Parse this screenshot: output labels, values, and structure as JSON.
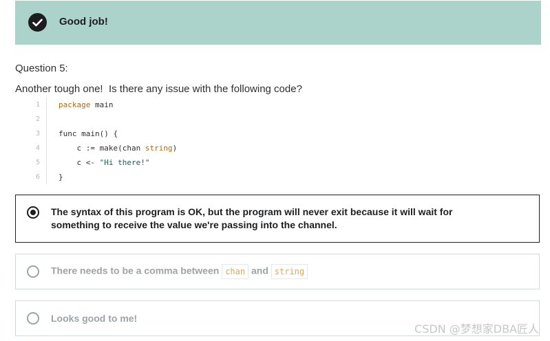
{
  "banner": {
    "message": "Good job!",
    "background": "#acd2cc",
    "icon": "check-circle-icon"
  },
  "question": {
    "label": "Question 5:",
    "prompt": "Another tough one!  Is there any issue with the following code?"
  },
  "code": {
    "lines": [
      {
        "num": "1",
        "text": "package main"
      },
      {
        "num": "2",
        "text": ""
      },
      {
        "num": "3",
        "text": "func main() {"
      },
      {
        "num": "4",
        "text": "    c := make(chan string)"
      },
      {
        "num": "5",
        "text": "    c <- \"Hi there!\""
      },
      {
        "num": "6",
        "text": "}"
      }
    ]
  },
  "options": [
    {
      "text_line1": "The syntax of this program is OK, but the program will never exit because it will wait for",
      "text_line2": "something to receive the value we're passing into the channel.",
      "selected": true
    },
    {
      "text_before": "There needs to be a comma between",
      "code1": "chan",
      "text_mid": "and",
      "code2": "string",
      "selected": false
    },
    {
      "text": "Looks good to me!",
      "selected": false
    }
  ],
  "watermark": "CSDN @梦想家DBA匠人"
}
